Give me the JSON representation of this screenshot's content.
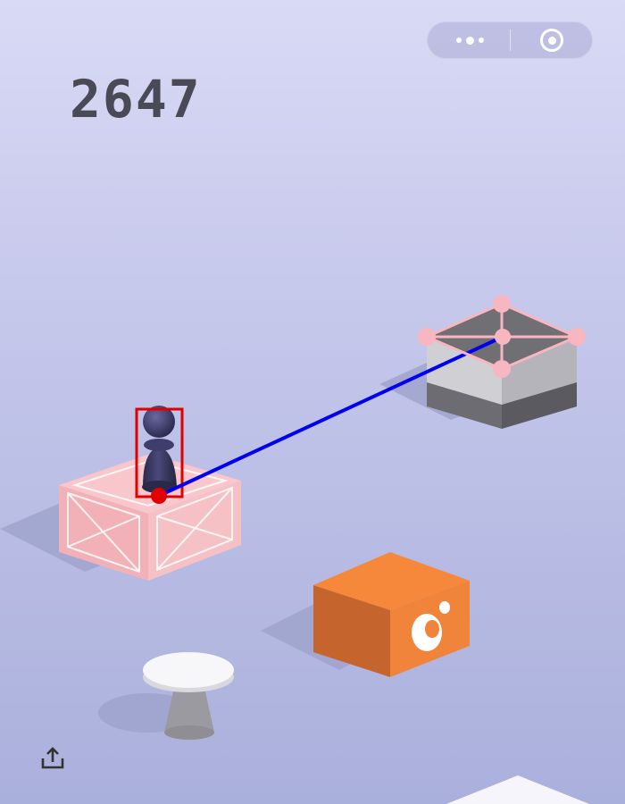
{
  "game": {
    "score": "2647",
    "menu_capsule": {
      "more_icon": "more-dots-icon",
      "close_icon": "target-ring-icon"
    },
    "share_icon": "share-upload-icon",
    "colors": {
      "score": "#4a4a56",
      "player": "#3b3a63",
      "jump_line": "#0000ee",
      "player_bbox": "#e00000",
      "target_markers": "#f7b6c0",
      "orange_box": "#f0843a",
      "pink_box": "#f3b3b8"
    }
  }
}
